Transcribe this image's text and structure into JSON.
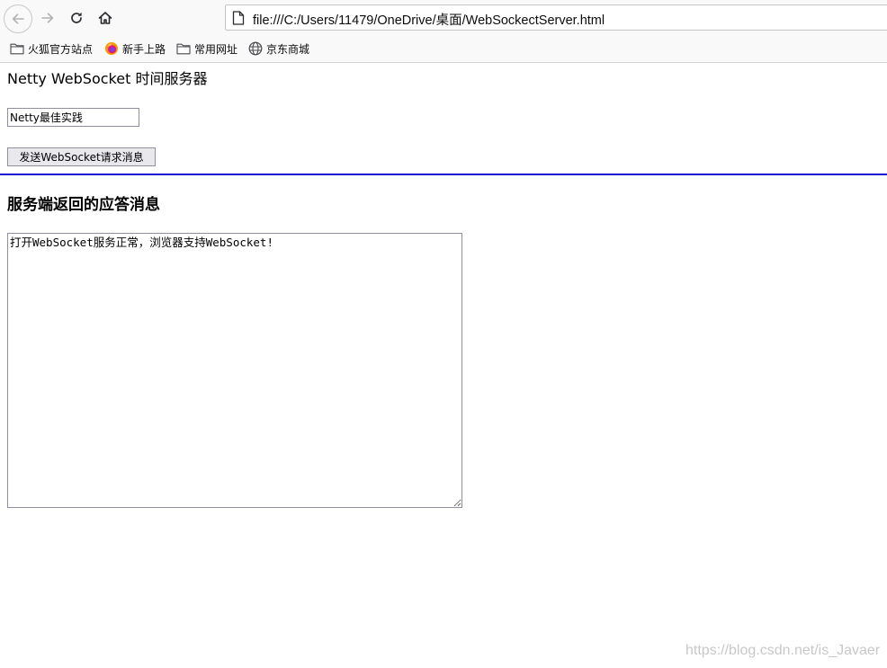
{
  "browser": {
    "url": "file:///C:/Users/11479/OneDrive/桌面/WebSockectServer.html",
    "bookmarks": [
      {
        "label": "火狐官方站点",
        "icon": "folder-icon"
      },
      {
        "label": "新手上路",
        "icon": "firefox-icon"
      },
      {
        "label": "常用网址",
        "icon": "folder-icon"
      },
      {
        "label": "京东商城",
        "icon": "globe-icon"
      }
    ]
  },
  "page": {
    "title": "Netty WebSocket 时间服务器",
    "input_value": "Netty最佳实践",
    "send_button_label": "发送WebSocket请求消息",
    "response_heading": "服务端返回的应答消息",
    "response_text": "打开WebSocket服务正常，浏览器支持WebSocket!"
  },
  "watermark": "https://blog.csdn.net/is_Javaer",
  "colors": {
    "divider": "#1010d0",
    "chrome_background": "#f9f9fa"
  }
}
